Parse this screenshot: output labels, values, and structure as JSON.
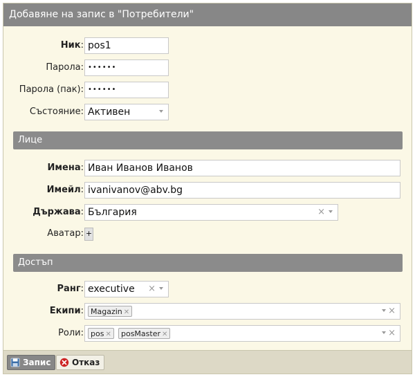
{
  "dialog": {
    "title": "Добавяне на запис в \"Потребители\""
  },
  "form": {
    "nick": {
      "label": "Ник",
      "value": "pos1"
    },
    "password": {
      "label": "Парола:",
      "value": "••••••"
    },
    "password_repeat": {
      "label": "Парола (пак):",
      "value": "••••••"
    },
    "state": {
      "label": "Състояние:",
      "value": "Активен"
    }
  },
  "sections": {
    "person": "Лице",
    "access": "Достъп"
  },
  "person": {
    "names": {
      "label": "Имена",
      "value": "Иван Иванов Иванов"
    },
    "email": {
      "label": "Имейл",
      "value": "ivanivanov@abv.bg"
    },
    "country": {
      "label": "Държава",
      "value": "България"
    },
    "avatar": {
      "label": "Аватар:",
      "button": "+"
    }
  },
  "access": {
    "rank": {
      "label": "Ранг",
      "value": "executive"
    },
    "teams": {
      "label": "Екипи",
      "tags": [
        "Magazin"
      ]
    },
    "roles": {
      "label": "Роли:",
      "tags": [
        "pos",
        "posMaster"
      ]
    }
  },
  "footer": {
    "save_label": "Запис",
    "cancel_label": "Отказ"
  },
  "colors": {
    "titlebar": "#878787",
    "panel": "#fbf8e6",
    "footer": "#ddd9c6",
    "cancel_icon": "#cc2222",
    "save_icon": "#3b6ea8"
  }
}
